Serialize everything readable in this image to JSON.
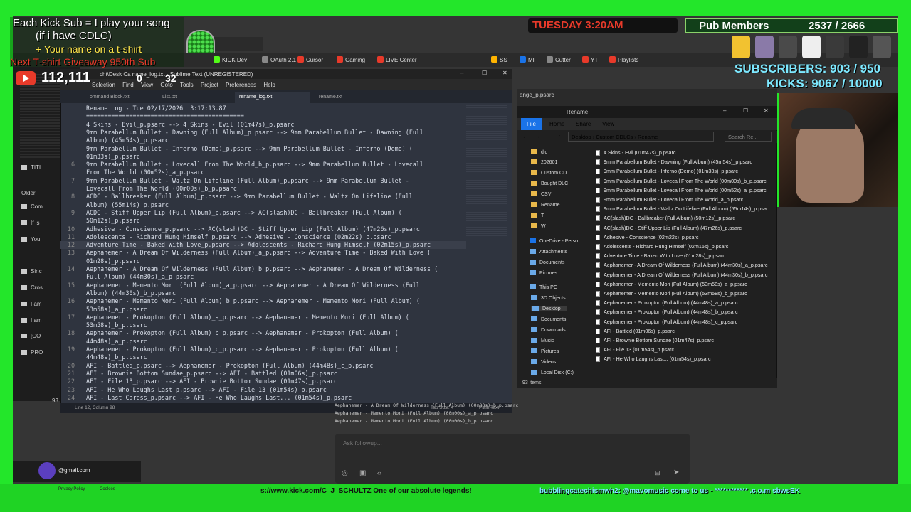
{
  "overlay": {
    "sub_promo_1": "Each Kick Sub = I play your song",
    "sub_promo_2": "(if i have CDLC)",
    "sub_promo_3": "+ Your name on a t-shirt",
    "sub_promo_4": "Next T-shirt Giveaway 950th Sub",
    "yt_count": "112,111",
    "yt_extra_1": "0",
    "yt_extra_2": "32",
    "day_time": "TUESDAY 3:20AM",
    "pub_members_label": "Pub Members",
    "pub_members_count": "2537 / 2666",
    "subscribers": "SUBSCRIBERS: 903 / 950",
    "kicks": "KICKS: 9067 / 10000",
    "ticker": "s://www.kick.com/C_J_SCHULTZ One of our absolute legends!",
    "ticker_right": "bubblingcatechismwh2: @mavomusic come to us - ************ .c.o.m sbwsEK",
    "colors": {
      "green": "#23e62a",
      "yellow": "#ffe64a",
      "red": "#e83a2a",
      "cyan": "#7de8ff"
    }
  },
  "browser": {
    "tab_id": "01aac",
    "url_fragment": "ch",
    "bookmarks": [
      "KICK Dev",
      "OAuth 2.1",
      "Cursor",
      "Gaming",
      "LIVE Center",
      "SS",
      "MF",
      "Cutter",
      "YT",
      "Playlists"
    ]
  },
  "left_panel": {
    "items": [
      "TITL",
      "Older",
      "Com",
      "If is",
      "You",
      "Sinc",
      "Cros",
      "I am",
      "I am",
      "[CO",
      "PRO",
      "93"
    ]
  },
  "sublime": {
    "title": "cht\\Desk         Ca     name_log.txt - Sublime Text (UNREGISTERED)",
    "menu": [
      "Selection",
      "Find",
      "View",
      "Goto",
      "Tools",
      "Project",
      "Preferences",
      "Help"
    ],
    "tabs": [
      "ommand Block.txt",
      "List.txt",
      "rename_log.txt",
      "rename.txt"
    ],
    "status_left": "Line 12, Column 98",
    "status_tab": "Tab Size: 4",
    "status_syntax": "Plain Text",
    "lines": [
      {
        "n": "",
        "t": "Rename Log - Tue 02/17/2026  3:17:13.87"
      },
      {
        "n": "",
        "t": "============================================"
      },
      {
        "n": "",
        "t": "4 Skins - Evil_p.psarc --> 4 Skins - Evil (01m47s)_p.psarc"
      },
      {
        "n": "",
        "t": "9mm Parabellum Bullet - Dawning (Full Album)_p.psarc --> 9mm Parabellum Bullet - Dawning (Full"
      },
      {
        "n": "",
        "t": "Album) (45m54s)_p.psarc"
      },
      {
        "n": "",
        "t": "9mm Parabellum Bullet - Inferno (Demo)_p.psarc --> 9mm Parabellum Bullet - Inferno (Demo) ("
      },
      {
        "n": "",
        "t": "01m33s)_p.psarc"
      },
      {
        "n": "6",
        "t": "9mm Parabellum Bullet - Lovecall From The World_b_p.psarc --> 9mm Parabellum Bullet - Lovecall"
      },
      {
        "n": "",
        "t": "From The World (00m52s)_a_p.psarc"
      },
      {
        "n": "7",
        "t": "9mm Parabellum Bullet - Waltz On Lifeline (Full Album)_p.psarc --> 9mm Parabellum Bullet -"
      },
      {
        "n": "",
        "t": "Lovecall From The World (00m00s)_b_p.psarc"
      },
      {
        "n": "8",
        "t": "ACDC - Ballbreaker (Full Album)_p.psarc --> 9mm Parabellum Bullet - Waltz On Lifeline (Full"
      },
      {
        "n": "",
        "t": "Album) (55m14s)_p.psarc"
      },
      {
        "n": "9",
        "t": "ACDC - Stiff Upper Lip (Full Album)_p.psarc --> AC(slash)DC - Ballbreaker (Full Album) ("
      },
      {
        "n": "",
        "t": "50m12s)_p.psarc"
      },
      {
        "n": "10",
        "t": "Adhesive - Conscience_p.psarc --> AC(slash)DC - Stiff Upper Lip (Full Album) (47m26s)_p.psarc"
      },
      {
        "n": "11",
        "t": "Adolescents - Richard Hung Himself_p.psarc --> Adhesive - Conscience (02m22s)_p.psarc"
      },
      {
        "n": "12",
        "t": "Adventure Time - Baked With Love_p.psarc --> Adolescents - Richard Hung Himself (02m15s)_p.psarc"
      },
      {
        "n": "13",
        "t": "Aephanemer - A Dream Of Wilderness (Full Album)_a_p.psarc --> Adventure Time - Baked With Love ("
      },
      {
        "n": "",
        "t": "01m28s)_p.psarc"
      },
      {
        "n": "14",
        "t": "Aephanemer - A Dream Of Wilderness (Full Album)_b_p.psarc --> Aephanemer - A Dream Of Wilderness ("
      },
      {
        "n": "",
        "t": "Full Album) (44m30s)_a_p.psarc"
      },
      {
        "n": "15",
        "t": "Aephanemer - Memento Mori (Full Album)_a_p.psarc --> Aephanemer - A Dream Of Wilderness (Full"
      },
      {
        "n": "",
        "t": "Album) (44m30s)_b_p.psarc"
      },
      {
        "n": "16",
        "t": "Aephanemer - Memento Mori (Full Album)_b_p.psarc --> Aephanemer - Memento Mori (Full Album) ("
      },
      {
        "n": "",
        "t": "53m58s)_a_p.psarc"
      },
      {
        "n": "17",
        "t": "Aephanemer - Prokopton (Full Album)_a_p.psarc --> Aephanemer - Memento Mori (Full Album) ("
      },
      {
        "n": "",
        "t": "53m58s)_b_p.psarc"
      },
      {
        "n": "18",
        "t": "Aephanemer - Prokopton (Full Album)_b_p.psarc --> Aephanemer - Prokopton (Full Album) ("
      },
      {
        "n": "",
        "t": "44m48s)_a_p.psarc"
      },
      {
        "n": "19",
        "t": "Aephanemer - Prokopton (Full Album)_c_p.psarc --> Aephanemer - Prokopton (Full Album) ("
      },
      {
        "n": "",
        "t": "44m48s)_b_p.psarc"
      },
      {
        "n": "20",
        "t": "AFI - Battled_p.psarc --> Aephanemer - Prokopton (Full Album) (44m48s)_c_p.psarc"
      },
      {
        "n": "21",
        "t": "AFI - Brownie Bottom Sundae_p.psarc --> AFI - Battled (01m06s)_p.psarc"
      },
      {
        "n": "22",
        "t": "AFI - File 13_p.psarc --> AFI - Brownie Bottom Sundae (01m47s)_p.psarc"
      },
      {
        "n": "23",
        "t": "AFI - He Who Laughs Last_p.psarc --> AFI - File 13 (01m54s)_p.psarc"
      },
      {
        "n": "24",
        "t": "AFI - Last Caress_p.psarc --> AFI - He Who Laughs Last... (01m54s)_p.psarc"
      }
    ]
  },
  "explorer": {
    "title": "Rename",
    "ribbon": [
      "File",
      "Home",
      "Share",
      "View"
    ],
    "path": [
      "Desktop",
      "Custom CDLCs",
      "Rename"
    ],
    "search_placeholder": "Search Re...",
    "behind_title": "ange_p.psarc",
    "nav": [
      "dlc",
      "202601",
      "Custom CD",
      "Bought DLC",
      "CSV",
      "Rename",
      "T",
      "W",
      "OneDrive - Perso",
      "Attachments",
      "Documents",
      "Pictures",
      "This PC",
      "3D Objects",
      "Desktop",
      "Documents",
      "Downloads",
      "Music",
      "Pictures",
      "Videos",
      "Local Disk (C:)"
    ],
    "files": [
      "4 Skins - Evil (01m47s)_p.psarc",
      "9mm Parabellum Bullet - Dawning (Full Album) (45m54s)_p.psarc",
      "9mm Parabellum Bullet - Inferno (Demo) (01m33s)_p.psarc",
      "9mm Parabellum Bullet - Lovecall From The World (00m00s)_b_p.psarc",
      "9mm Parabellum Bullet - Lovecall From The World (00m52s)_a_p.psarc",
      "9mm Parabellum Bullet - Lovecall From The World_a_p.psarc",
      "9mm Parabellum Bullet - Waltz On Lifeline (Full Album) (55m14s)_p.psa",
      "AC(slash)DC - Ballbreaker (Full Album) (50m12s)_p.psarc",
      "AC(slash)DC - Stiff Upper Lip (Full Album) (47m26s)_p.psarc",
      "Adhesive - Conscience (02m22s)_p.psarc",
      "Adolescents - Richard Hung Himself (02m15s)_p.psarc",
      "Adventure Time - Baked With Love (01m28s)_p.psarc",
      "Aephanemer - A Dream Of Wilderness (Full Album) (44m30s)_a_p.psarc",
      "Aephanemer - A Dream Of Wilderness (Full Album) (44m30s)_b_p.psarc",
      "Aephanemer - Memento Mori (Full Album) (53m58s)_a_p.psarc",
      "Aephanemer - Memento Mori (Full Album) (53m58s)_b_p.psarc",
      "Aephanemer - Prokopton (Full Album) (44m48s)_a_p.psarc",
      "Aephanemer - Prokopton (Full Album) (44m48s)_b_p.psarc",
      "Aephanemer - Prokopton (Full Album) (44m48s)_c_p.psarc",
      "AFI - Battled (01m06s)_p.psarc",
      "AFI - Brownie Bottom Sundae (01m47s)_p.psarc",
      "AFI - File 13 (01m54s)_p.psarc",
      "AFI - He Who Laughs Last... (01m54s)_p.psarc"
    ],
    "item_count": "93 items"
  },
  "chat": {
    "lines": [
      "Aephanemer - A Dream Of Wilderness (Full Album) (00m00s)_b_p.psarc",
      "Aephanemer - Memento Mori (Full Album) (00m00s)_a_p.psarc",
      "Aephanemer - Memento Mori (Full Album) (00m00s)_b_p.psarc"
    ],
    "followup_placeholder": "Ask followup...",
    "gmail": "@gmail.com",
    "privacy": "Privacy Policy",
    "cookies": "Cookies"
  }
}
